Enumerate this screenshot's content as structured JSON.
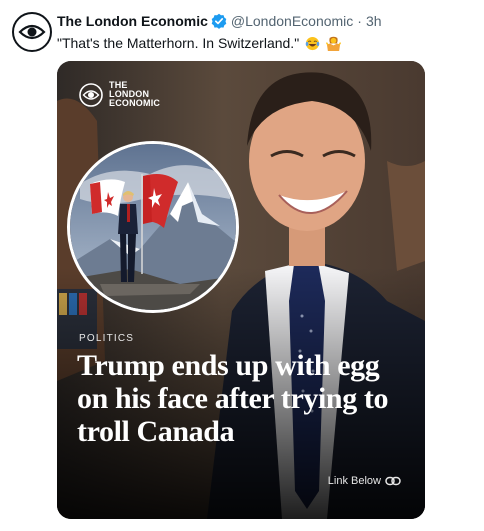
{
  "tweet": {
    "author_name": "The London Economic",
    "handle": "@LondonEconomic",
    "separator": "·",
    "time": "3h",
    "text": "\"That's the Matterhorn. In Switzerland.\"",
    "emojis": [
      "face-with-tears-of-joy",
      "person-shrugging"
    ],
    "verified_color": "#1d9bf0"
  },
  "media": {
    "brand_lines": [
      "THE",
      "LONDON",
      "ECONOMIC"
    ],
    "category": "POLITICS",
    "headline_lines": [
      "Trump ends up with egg",
      "on his face after trying to",
      "troll Canada"
    ],
    "link_label": "Link Below"
  }
}
